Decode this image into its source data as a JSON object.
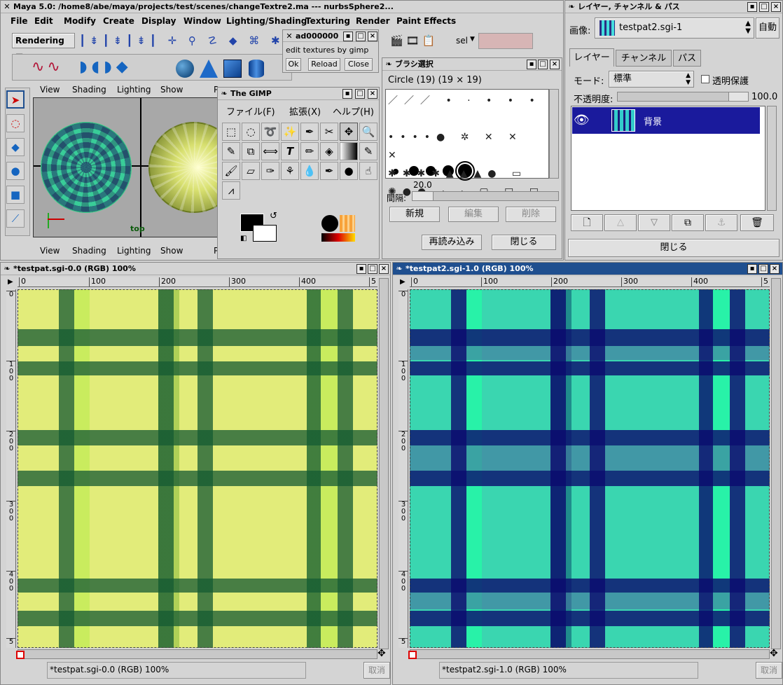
{
  "maya": {
    "title": "Maya 5.0: /home8/abe/maya/projects/test/scenes/changeTextre2.ma  ---  nurbsSphere2...",
    "menu": [
      "File",
      "Edit",
      "Modify",
      "Create",
      "Display",
      "Window",
      "Lighting/Shading",
      "Texturing",
      "Render",
      "Paint Effects"
    ],
    "menuset": "Rendering",
    "sel_label": "sel",
    "panel_menu": [
      "View",
      "Shading",
      "Lighting",
      "Show",
      "P"
    ],
    "view_label": "top"
  },
  "plugin": {
    "title": "ad000000",
    "text": "edit textures by gimp",
    "buttons": [
      "Ok",
      "Reload",
      "Close"
    ]
  },
  "gimp": {
    "title": "The GIMP",
    "menu": [
      "ファイル(F)",
      "拡張(X)",
      "ヘルプ(H)"
    ]
  },
  "brush": {
    "title": "ブラシ選択",
    "name": "Circle (19)  (19 × 19)",
    "spacing_value": "20.0",
    "spacing_label": "間隔:",
    "buttons": [
      "新規",
      "編集",
      "削除"
    ],
    "bottom_buttons": [
      "再読み込み",
      "閉じる"
    ]
  },
  "layers": {
    "title": "レイヤー, チャンネル & パス",
    "image_label": "画像:",
    "image_name": "testpat2.sgi-1",
    "auto_label": "自動",
    "tabs": [
      "レイヤー",
      "チャンネル",
      "パス"
    ],
    "mode_label": "モード:",
    "mode_value": "標準",
    "keep_trans": "透明保護",
    "opacity_label": "不透明度:",
    "opacity_value": "100.0",
    "layer_name": "背景",
    "close_label": "閉じる"
  },
  "img1": {
    "title": "*testpat.sgi-0.0 (RGB) 100%",
    "status": "*testpat.sgi-0.0 (RGB) 100%",
    "cancel": "取消",
    "ruler_h": [
      "0",
      "100",
      "200",
      "300",
      "400",
      "5"
    ],
    "ruler_v": [
      "0",
      "1\n0\n0",
      "2\n0\n0",
      "3\n0\n0",
      "4\n0\n0",
      "5"
    ]
  },
  "img2": {
    "title": "*testpat2.sgi-1.0 (RGB) 100%",
    "status": "*testpat2.sgi-1.0 (RGB) 100%",
    "cancel": "取消",
    "ruler_h": [
      "0",
      "100",
      "200",
      "300",
      "400",
      "5"
    ],
    "ruler_v": [
      "0",
      "1\n0\n0",
      "2\n0\n0",
      "3\n0\n0",
      "4\n0\n0",
      "5"
    ]
  },
  "colors": {
    "active_title": "#1f4f8f",
    "layer_select": "#1a1a9c",
    "sel_field": "#d7b5b5"
  }
}
